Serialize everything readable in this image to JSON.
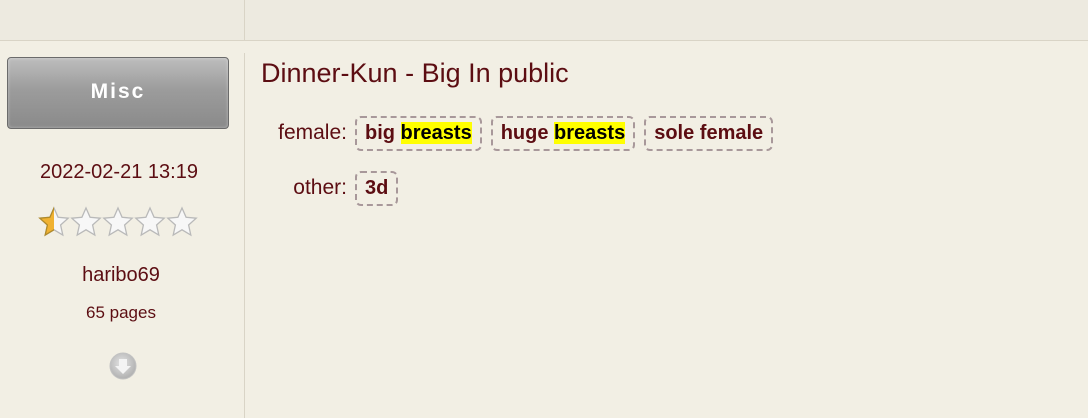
{
  "gallery": {
    "category": "Misc",
    "posted": "2022-02-21 13:19",
    "rating": {
      "value": 0.5,
      "max": 5
    },
    "uploader": "haribo69",
    "pages": "65 pages",
    "title": "Dinner-Kun - Big In public",
    "tags": {
      "female": {
        "label": "female:",
        "items": [
          {
            "pre": "big ",
            "hl": "breasts"
          },
          {
            "pre": "huge ",
            "hl": "breasts"
          },
          {
            "pre": "sole female",
            "hl": ""
          }
        ]
      },
      "other": {
        "label": "other:",
        "items": [
          {
            "pre": "3d",
            "hl": ""
          }
        ]
      }
    }
  },
  "colors": {
    "text": "#5c0d12",
    "highlight": "#ffff00",
    "background": "#f2efe4",
    "star_fill": "#f0b232"
  },
  "icons": {
    "rating": "star-icon",
    "download": "download-arrow-icon"
  }
}
